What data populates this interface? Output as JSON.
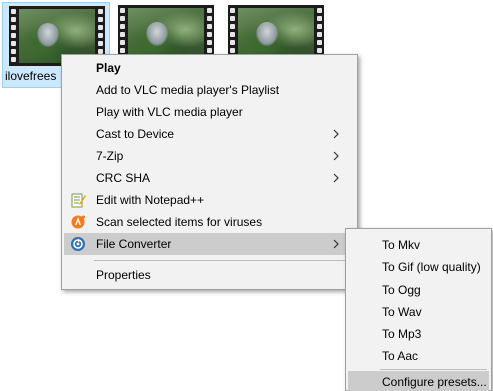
{
  "files": [
    {
      "name": "ilovefrees",
      "selected": true
    },
    {
      "name": "",
      "selected": false
    },
    {
      "name": "",
      "selected": false
    }
  ],
  "context_menu": {
    "items": [
      {
        "label": "Play",
        "bold": true
      },
      {
        "label": "Add to VLC media player's Playlist"
      },
      {
        "label": "Play with VLC media player"
      },
      {
        "label": "Cast to Device",
        "submenu": true
      },
      {
        "label": "7-Zip",
        "submenu": true
      },
      {
        "label": "CRC SHA",
        "submenu": true
      },
      {
        "label": "Edit with Notepad++",
        "icon": "notepad-plus-plus-icon"
      },
      {
        "label": "Scan selected items for viruses",
        "icon": "avast-icon"
      },
      {
        "label": "File Converter",
        "icon": "file-converter-icon",
        "submenu": true,
        "highlighted": true
      },
      {
        "label": "Properties"
      }
    ]
  },
  "file_converter_submenu": {
    "items": [
      {
        "label": "To Mkv"
      },
      {
        "label": "To Gif (low quality)"
      },
      {
        "label": "To Ogg"
      },
      {
        "label": "To Wav"
      },
      {
        "label": "To Mp3"
      },
      {
        "label": "To Aac"
      },
      {
        "label": "Configure presets...",
        "highlighted": true
      }
    ]
  },
  "colors": {
    "menu_background": "#f2f2f2",
    "menu_highlight": "#cccccc",
    "selection_background": "#cce8ff",
    "selection_border": "#99d1ff"
  }
}
